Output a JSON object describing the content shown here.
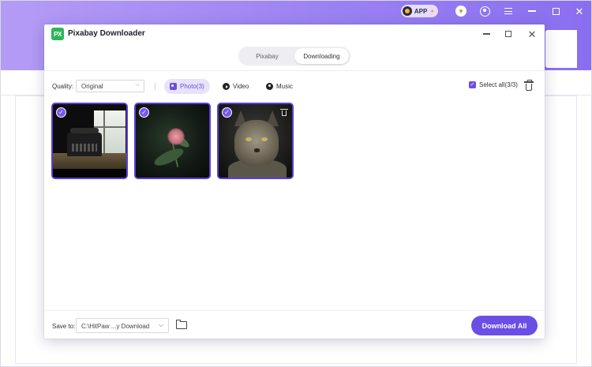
{
  "topbar": {
    "app_pill_label": "APP",
    "icons": [
      "app-badge-icon",
      "cart-icon",
      "user-icon",
      "menu-icon",
      "minimize-icon",
      "maximize-icon",
      "close-icon"
    ]
  },
  "dialog": {
    "logo_text": "PX",
    "title": "Pixabay Downloader",
    "tabs": [
      {
        "label": "Pixabay",
        "active": false
      },
      {
        "label": "Downloading",
        "active": true
      }
    ],
    "toolbar": {
      "quality_label": "Quality:",
      "quality_value": "Original",
      "filters": [
        {
          "label": "Photo(3)",
          "icon": "photo-icon",
          "active": true
        },
        {
          "label": "Video",
          "icon": "video-icon",
          "active": false
        },
        {
          "label": "Music",
          "icon": "music-icon",
          "active": false
        }
      ],
      "select_all_label": "Select all(3/3)",
      "select_all_checked": true
    },
    "items": [
      {
        "kind": "photo",
        "subject": "typewriter",
        "selected": true
      },
      {
        "kind": "photo",
        "subject": "flower",
        "selected": true
      },
      {
        "kind": "photo",
        "subject": "lynx",
        "selected": true,
        "show_delete": true
      }
    ],
    "footer": {
      "save_label": "Save to:",
      "save_path": "C:\\HitPaw ...y Download",
      "download_all_label": "Download All"
    }
  },
  "colors": {
    "accent": "#6b4ee6",
    "header_gradient_start": "#b49cf5",
    "header_gradient_end": "#8a6ef0",
    "logo_green": "#2fb45a"
  }
}
